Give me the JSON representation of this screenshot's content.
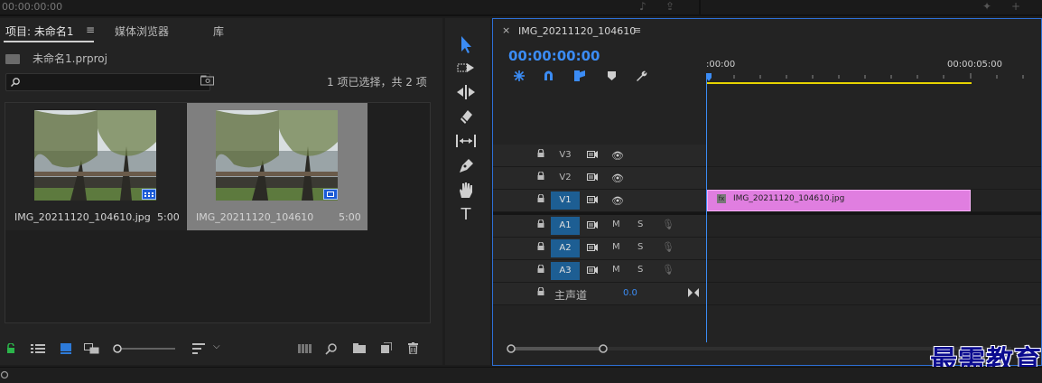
{
  "top_strip": {
    "timecode": "00:00:00:00"
  },
  "project_panel": {
    "tabs": [
      {
        "label": "项目: 未命名1"
      },
      {
        "label": "媒体浏览器"
      },
      {
        "label": "库"
      }
    ],
    "menu_glyph": "≡",
    "project_file": "未命名1.prproj",
    "search": {
      "value": "",
      "placeholder": ""
    },
    "selection_status": "1 项已选择，共 2 项",
    "clips": [
      {
        "name": "IMG_20211120_104610.jpg",
        "duration": "5:00",
        "selected": false
      },
      {
        "name": "IMG_20211120_104610",
        "duration": "5:00",
        "selected": true
      }
    ]
  },
  "tools_panel": {
    "tools": [
      "selection-tool",
      "track-select-tool",
      "ripple-edit-tool",
      "razor-tool",
      "slip-tool",
      "pen-tool",
      "hand-tool",
      "type-tool"
    ],
    "type_tool_glyph": "T"
  },
  "timeline": {
    "close_glyph": "×",
    "menu_glyph": "≡",
    "sequence_title": "IMG_20211120_104610",
    "timecode": "00:00:00:00",
    "ruler": {
      "start": ":00:00",
      "mark": "00:00:05:00"
    },
    "video_tracks": [
      "V3",
      "V2",
      "V1"
    ],
    "audio_tracks": [
      "A1",
      "A2",
      "A3"
    ],
    "audio_controls": {
      "mute": "M",
      "solo": "S"
    },
    "selected_track": "V1",
    "master": {
      "label": "主声道",
      "value": "0.0"
    },
    "clip": {
      "label": "IMG_20211120_104610.jpg",
      "track": "V1",
      "fx_glyph": "fx"
    }
  },
  "watermark": "最需教育",
  "colors": {
    "accent": "#3b8cf5",
    "clip": "#e07ee0",
    "track_selected": "#1d5e93",
    "work_area": "#e6d300",
    "lock_active": "#2bb44a"
  }
}
